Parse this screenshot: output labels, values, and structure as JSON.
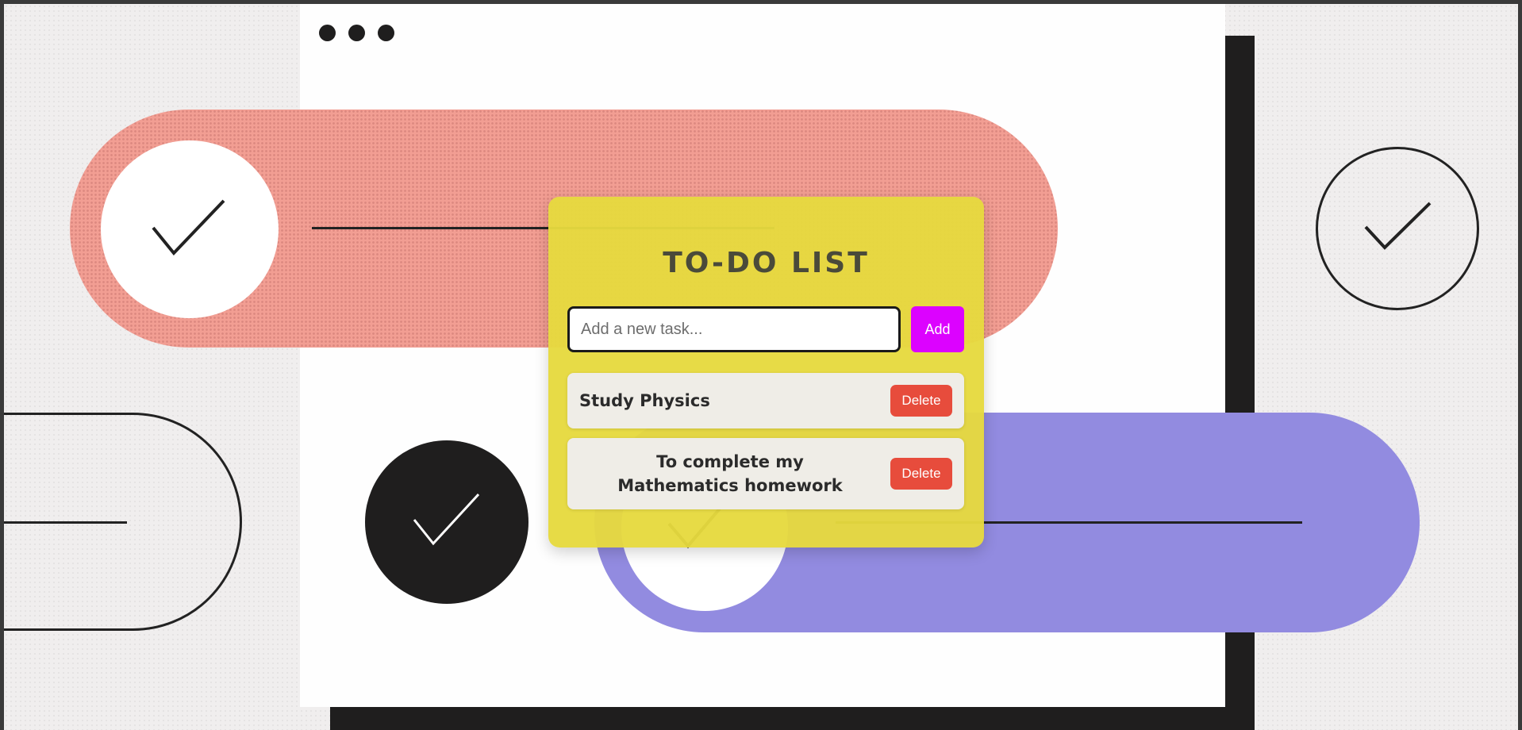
{
  "window": {
    "controls": [
      "dot",
      "dot",
      "dot"
    ]
  },
  "decor": {
    "colors": {
      "pink": "#f29e93",
      "purple": "#928be0",
      "dark": "#1f1e1e",
      "card": "#e6da3e"
    },
    "icons": [
      "check-icon",
      "check-icon",
      "check-icon",
      "check-icon"
    ]
  },
  "todo": {
    "title": "TO-DO LIST",
    "input": {
      "placeholder": "Add a new task...",
      "value": ""
    },
    "add_label": "Add",
    "tasks": [
      {
        "text": "Study Physics",
        "delete_label": "Delete"
      },
      {
        "text": "To complete my Mathematics homework",
        "delete_label": "Delete"
      }
    ],
    "colors": {
      "add": "#dc02ff",
      "delete": "#e74c3c"
    }
  }
}
